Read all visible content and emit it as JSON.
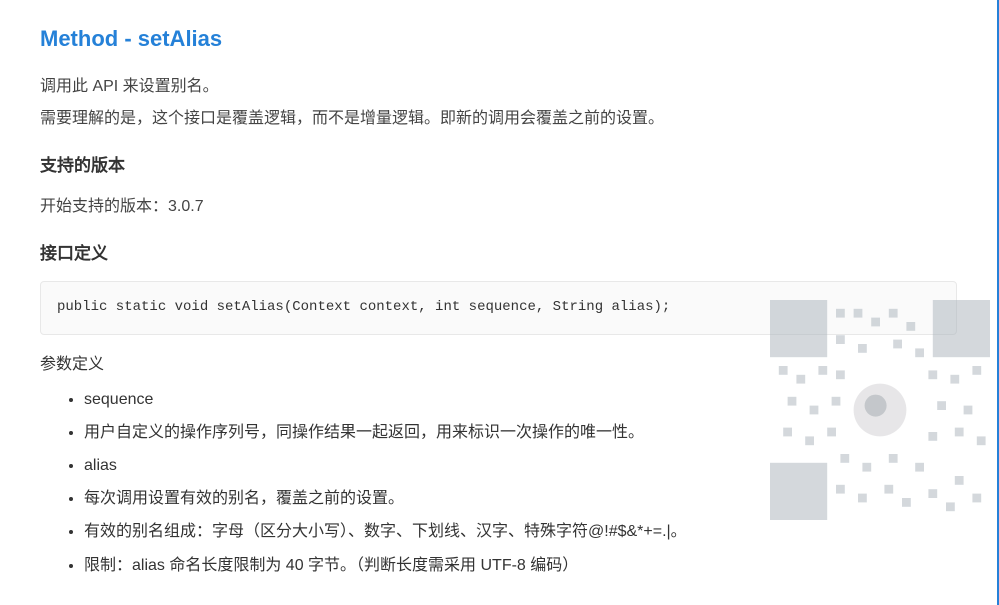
{
  "title": "Method - setAlias",
  "intro_line1": "调用此 API 来设置别名。",
  "intro_line2": "需要理解的是，这个接口是覆盖逻辑，而不是增量逻辑。即新的调用会覆盖之前的设置。",
  "version_heading": "支持的版本",
  "version_text": "开始支持的版本：3.0.7",
  "interface_heading": "接口定义",
  "code": "public static void setAlias(Context context, int sequence, String alias);",
  "params_heading": "参数定义",
  "params": [
    "sequence",
    "用户自定义的操作序列号，同操作结果一起返回，用来标识一次操作的唯一性。",
    "alias",
    "每次调用设置有效的别名，覆盖之前的设置。",
    "有效的别名组成：字母（区分大小写）、数字、下划线、汉字、特殊字符@!#$&*+=.|。",
    "限制：alias 命名长度限制为 40 字节。（判断长度需采用 UTF-8 编码）"
  ]
}
